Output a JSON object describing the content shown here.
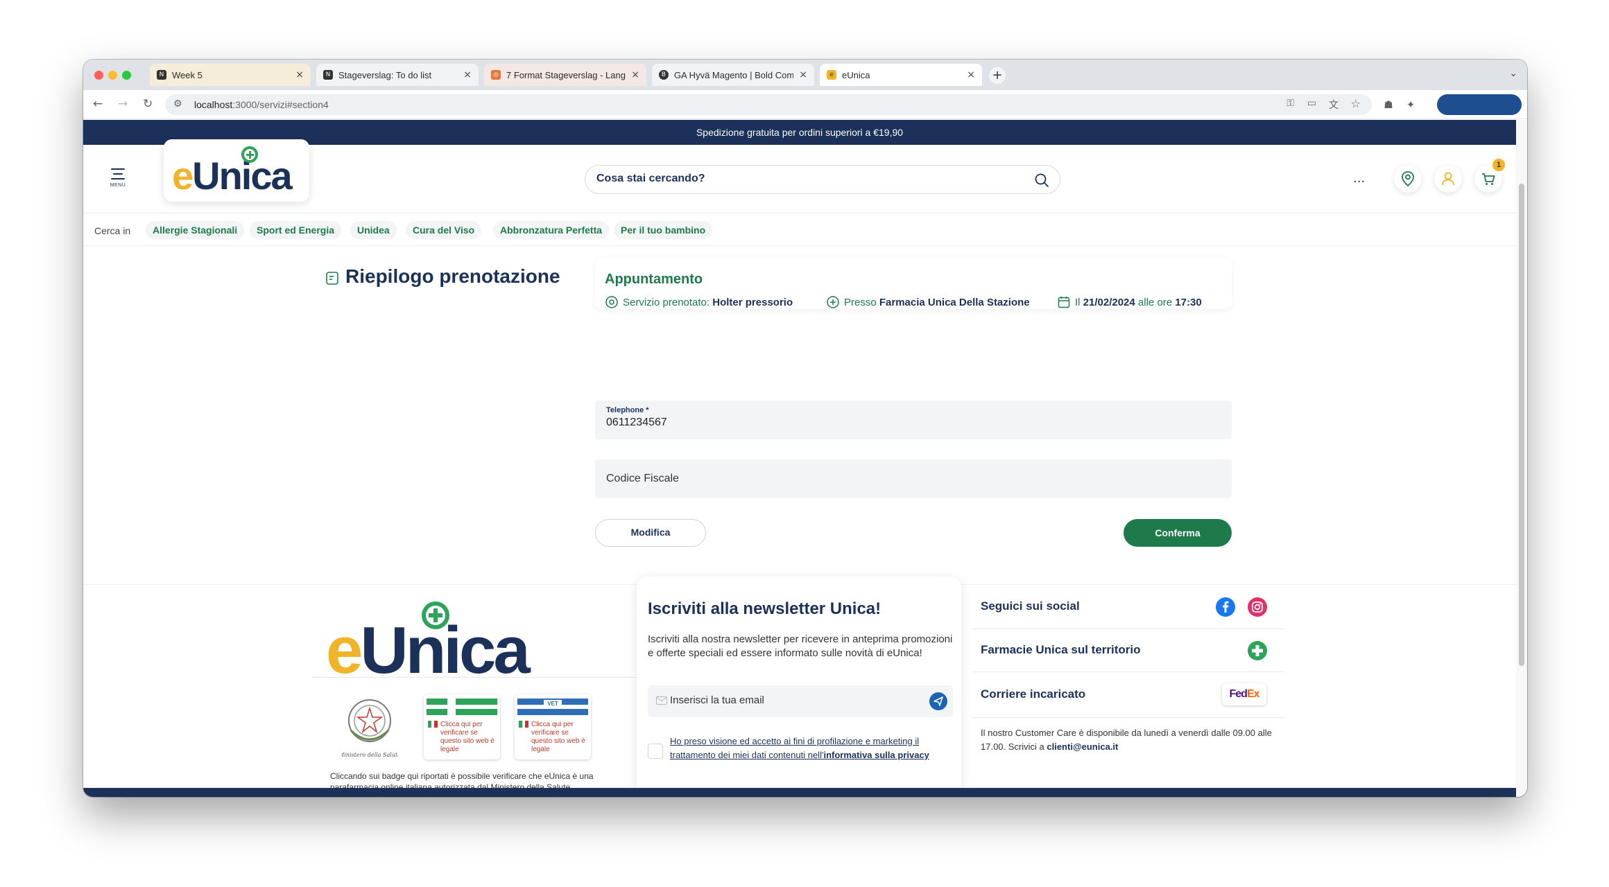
{
  "browser": {
    "tabs": [
      {
        "title": "Week 5",
        "favicon": "N"
      },
      {
        "title": "Stageverslag: To do list",
        "favicon": "N"
      },
      {
        "title": "7 Format Stageverslag - Lang",
        "favicon": "◎"
      },
      {
        "title": "GA Hyvä Magento | Bold Com",
        "favicon": "B"
      },
      {
        "title": "eUnica",
        "favicon": "e"
      }
    ],
    "url_host": "localhost",
    "url_path": ":3000/servizi#section4"
  },
  "page": {
    "promo_text": "Spedizione gratuita per ordini superiori a €19,90",
    "menu_label": "MENU",
    "logo": {
      "e": "e",
      "rest": "Unica"
    },
    "search_placeholder": "Cosa stai cercando?",
    "more_label": "...",
    "cart_count": "1",
    "category_nav": {
      "label": "Cerca in",
      "items": [
        "Allergie Stagionali",
        "Sport ed Energia",
        "Unidea",
        "Cura del Viso",
        "Abbronzatura Perfetta",
        "Per il tuo bambino"
      ]
    },
    "summary_title": "Riepilogo prenotazione",
    "appointment": {
      "title": "Appuntamento",
      "service_label": "Servizio prenotato:",
      "service_value": "Holter pressorio",
      "location_label": "Presso",
      "location_value": "Farmacia Unica Della Stazione",
      "date_label": "Il",
      "date_value": "21/02/2024",
      "time_label": "alle ore",
      "time_value": "17:30"
    },
    "form": {
      "telephone_label": "Telephone *",
      "telephone_value": "0611234567",
      "codice_fiscale_placeholder": "Codice Fiscale",
      "modifica_label": "Modifica",
      "conferma_label": "Conferma"
    }
  },
  "footer": {
    "badge_text_1": "Clicca qui per verificare se questo sito web è legale",
    "badge_text_2": "Clicca qui per verificare se questo sito web è legale",
    "seal_caption": "Ministero della Salute",
    "note": "Cliccando sui badge qui riportati è possibile verificare che eUnica è una parafarmacia online italiana autorizzata dal Ministero della Salute.",
    "newsletter": {
      "title": "Iscriviti alla newsletter Unica!",
      "description": "Iscriviti alla nostra newsletter per ricevere in anteprima promozioni e offerte speciali ed essere informato sulle novità di eUnica!",
      "email_placeholder": "Inserisci la tua email",
      "consent_text": "Ho preso visione ed accetto ai fini di profilazione e marketing il trattamento dei miei dati contenuti nell'",
      "consent_link": "informativa sulla privacy"
    },
    "social_label": "Seguici sui social",
    "stores_label": "Farmacie Unica sul territorio",
    "courier_label": "Corriere incaricato",
    "courier_logo": {
      "fed": "Fed",
      "ex": "Ex"
    },
    "care_text": "Il nostro Customer Care è disponibile da lunedì a venerdì dalle 09.00 alle 17.00. Scrivici a ",
    "care_email": "clienti@eunica.it"
  },
  "colors": {
    "navy": "#1b3159",
    "green": "#1e7a4a",
    "yellow": "#f0b429",
    "facebook": "#1877f2",
    "instagram": "#e1306c"
  }
}
